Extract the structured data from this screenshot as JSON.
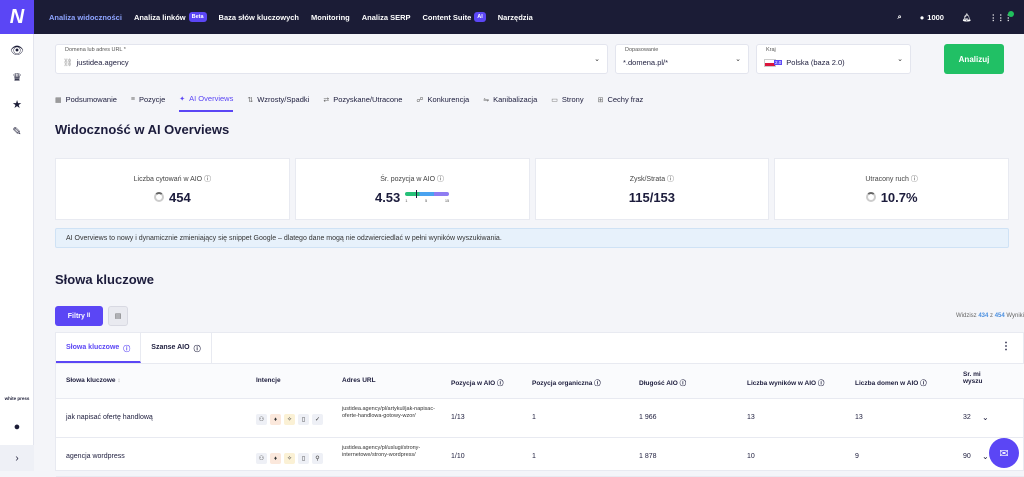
{
  "topnav": {
    "logo": "N",
    "items": [
      {
        "label": "Analiza widoczności",
        "active": true
      },
      {
        "label": "Analiza linków",
        "badge": "Beta"
      },
      {
        "label": "Baza słów kluczowych"
      },
      {
        "label": "Monitoring"
      },
      {
        "label": "Analiza SERP"
      },
      {
        "label": "Content Suite",
        "badge": "AI"
      },
      {
        "label": "Narzędzia"
      }
    ],
    "credits": "1000"
  },
  "sidebar": {
    "icons": [
      "eye-icon",
      "trophy-icon",
      "star-icon",
      "wrench-icon"
    ],
    "brand": "white press",
    "bottom_icon": "chevron-right-icon"
  },
  "filters": {
    "domain_label": "Domena lub adres URL *",
    "domain_value": "justidea.agency",
    "match_label": "Dopasowanie",
    "match_value": "*.domena.pl/*",
    "country_label": "Kraj",
    "country_value": "Polska (baza 2.0)",
    "flag_badge": "2.0",
    "analyze_button": "Analizuj"
  },
  "tabs": [
    {
      "label": "Podsumowanie",
      "icon": "▦"
    },
    {
      "label": "Pozycje",
      "icon": "≡"
    },
    {
      "label": "AI Overviews",
      "icon": "✦",
      "active": true
    },
    {
      "label": "Wzrosty/Spadki",
      "icon": "⇅"
    },
    {
      "label": "Pozyskane/Utracone",
      "icon": "⇄"
    },
    {
      "label": "Konkurencja",
      "icon": "☍"
    },
    {
      "label": "Kanibalizacja",
      "icon": "⇋"
    },
    {
      "label": "Strony",
      "icon": "▭"
    },
    {
      "label": "Cechy fraz",
      "icon": "⊞"
    }
  ],
  "page_title": "Widoczność w AI Overviews",
  "cards": [
    {
      "label": "Liczba cytowań w AIO",
      "value": "454"
    },
    {
      "label": "Śr. pozycja w AIO",
      "value": "4.53",
      "scale_min": "1",
      "scale_mid": "5",
      "scale_max": "15",
      "scale_position": 4.53
    },
    {
      "label": "Zysk/Strata",
      "value": "115/153"
    },
    {
      "label": "Utracony ruch",
      "value": "10.7%"
    }
  ],
  "info_text": "AI Overviews to nowy i dynamicznie zmieniający się snippet Google – dlatego dane mogą nie odzwierciedlać w pełni wyników wyszukiwania.",
  "keywords": {
    "title": "Słowa kluczowe",
    "filter_button": "Filtry",
    "filter_count": "II",
    "results_prefix": "Widzisz",
    "results_shown": "434",
    "results_of": "z",
    "results_total": "454",
    "results_suffix": "Wyniki",
    "subtabs": [
      "Słowa kluczowe",
      "Szanse AIO"
    ],
    "columns": [
      "Słowa kluczowe",
      "Intencje",
      "Adres URL",
      "Pozycja w AIO",
      "Pozycja organiczna",
      "Długość AIO",
      "Liczba wyników w AIO",
      "Liczba domen w AIO",
      "Śr. mi wyszu"
    ],
    "rows": [
      {
        "keyword": "jak napisać ofertę handlową",
        "url": "justidea.agency/pl/artykul/jak-napisac-oferte-handlowa-gotowy-wzor/",
        "aio_pos": "1/13",
        "organic": "1",
        "length": "1 966",
        "results": "13",
        "domains": "13",
        "avg": "32"
      },
      {
        "keyword": "agencja wordpress",
        "url": "justidea.agency/pl/uslugi/strony-internetowe/strony-wordpress/",
        "aio_pos": "1/10",
        "organic": "1",
        "length": "1 878",
        "results": "10",
        "domains": "9",
        "avg": "90"
      }
    ]
  }
}
